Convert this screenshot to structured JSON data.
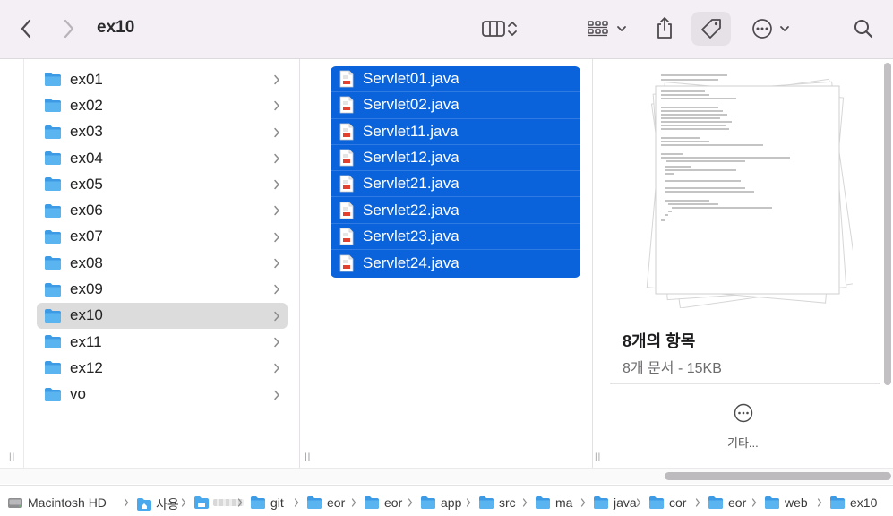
{
  "window": {
    "title": "ex10"
  },
  "folders": [
    {
      "label": "ex01",
      "selected": false
    },
    {
      "label": "ex02",
      "selected": false
    },
    {
      "label": "ex03",
      "selected": false
    },
    {
      "label": "ex04",
      "selected": false
    },
    {
      "label": "ex05",
      "selected": false
    },
    {
      "label": "ex06",
      "selected": false
    },
    {
      "label": "ex07",
      "selected": false
    },
    {
      "label": "ex08",
      "selected": false
    },
    {
      "label": "ex09",
      "selected": false
    },
    {
      "label": "ex10",
      "selected": true
    },
    {
      "label": "ex11",
      "selected": false
    },
    {
      "label": "ex12",
      "selected": false
    },
    {
      "label": "vo",
      "selected": false
    }
  ],
  "files": [
    "Servlet01.java",
    "Servlet02.java",
    "Servlet11.java",
    "Servlet12.java",
    "Servlet21.java",
    "Servlet22.java",
    "Servlet23.java",
    "Servlet24.java"
  ],
  "preview": {
    "title": "8개의 항목",
    "subtitle": "8개 문서 - 15KB",
    "more_label": "기타..."
  },
  "pathbar": [
    {
      "label": "Macintosh HD",
      "icon": "disk-icon"
    },
    {
      "label": "사용",
      "icon": "home-folder-icon"
    },
    {
      "label": "",
      "icon": "user-home-icon"
    },
    {
      "label": "git",
      "icon": "folder-icon"
    },
    {
      "label": "eor",
      "icon": "folder-icon"
    },
    {
      "label": "eor",
      "icon": "folder-icon"
    },
    {
      "label": "app",
      "icon": "folder-icon"
    },
    {
      "label": "src",
      "icon": "folder-icon"
    },
    {
      "label": "ma",
      "icon": "folder-icon"
    },
    {
      "label": "java",
      "icon": "folder-icon"
    },
    {
      "label": "cor",
      "icon": "folder-icon"
    },
    {
      "label": "eor",
      "icon": "folder-icon"
    },
    {
      "label": "web",
      "icon": "folder-icon"
    },
    {
      "label": "ex10",
      "icon": "folder-icon"
    }
  ],
  "colors": {
    "selection": "#0a63da",
    "folder": "#4aa8ec",
    "toolbar": "#f4eff4"
  }
}
